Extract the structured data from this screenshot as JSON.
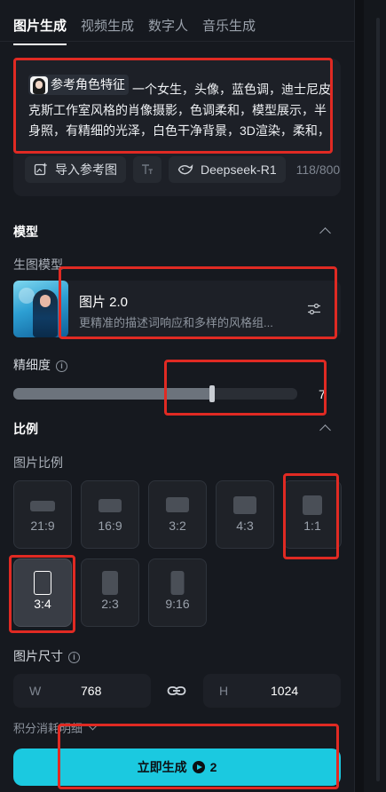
{
  "tabs": [
    {
      "label": "图片生成",
      "active": true
    },
    {
      "label": "视频生成",
      "active": false
    },
    {
      "label": "数字人",
      "active": false
    },
    {
      "label": "音乐生成",
      "active": false
    }
  ],
  "prompt": {
    "ref_chip": "参考角色特征",
    "text": "一个女生，头像，蓝色调，迪士尼皮克斯工作室风格的肖像摄影，色调柔和，模型展示，半身照，有精细的光泽，白色干净背景，3D渲染，柔和，Octane Render（OC），Blender",
    "import_button": "导入参考图",
    "model_button": "Deepseek-R1",
    "counter": "118/800"
  },
  "model_section": {
    "title": "模型",
    "sub_label": "生图模型",
    "model_name": "图片 2.0",
    "model_desc": "更精准的描述词响应和多样的风格组..."
  },
  "detail": {
    "label": "精细度",
    "value": 0.7,
    "value_text": "7"
  },
  "ratio_section": {
    "title": "比例",
    "sub_label": "图片比例",
    "options": [
      {
        "label": "21:9",
        "selected": false
      },
      {
        "label": "16:9",
        "selected": false
      },
      {
        "label": "3:2",
        "selected": false
      },
      {
        "label": "4:3",
        "selected": false
      },
      {
        "label": "1:1",
        "selected": false
      },
      {
        "label": "3:4",
        "selected": true
      },
      {
        "label": "2:3",
        "selected": false
      },
      {
        "label": "9:16",
        "selected": false
      }
    ]
  },
  "size": {
    "label": "图片尺寸",
    "w_label": "W",
    "w_value": "768",
    "h_label": "H",
    "h_value": "1024"
  },
  "cost": {
    "label": "积分消耗明细"
  },
  "generate": {
    "label": "立即生成",
    "cost": "2"
  },
  "colors": {
    "accent": "#1bc9e0",
    "annotation": "#e02a23",
    "panel": "#16191f"
  },
  "icons": [
    "image-import-icon",
    "text-format-icon",
    "deepseek-whale-icon",
    "settings-sliders-icon",
    "info-icon",
    "link-icon",
    "chevron-up-icon",
    "chevron-down-icon",
    "play-coin-icon"
  ]
}
